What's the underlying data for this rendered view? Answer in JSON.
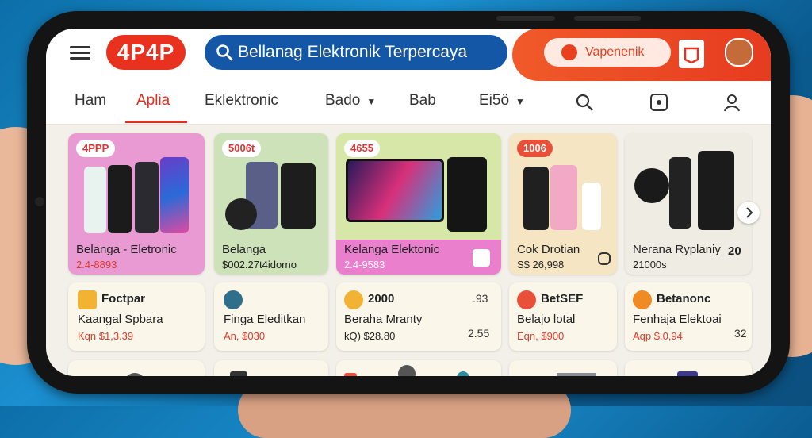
{
  "header": {
    "logo": "4P4P",
    "search_text": "Bellanag Elektronik Terpercaya",
    "promo_label": "Vapenenik"
  },
  "tabs": [
    {
      "label": "Ham"
    },
    {
      "label": "Aplia"
    },
    {
      "label": "Eklektronic"
    },
    {
      "label": "Bado"
    },
    {
      "label": "Bab"
    },
    {
      "label": "Ei5ö"
    }
  ],
  "product_cards": [
    {
      "badge": "4PPP",
      "title": "Belanga - Eletronic",
      "price": "2.4-8893",
      "bg": "#e99ad3"
    },
    {
      "badge": "5006t",
      "title": "Belanga",
      "price": "$002.27t4idorno",
      "bg": "#cde2b8"
    },
    {
      "badge": "4655",
      "title": "Kelanga Elektonic",
      "price": "2.4-9583",
      "bg": "#d6e7a8"
    },
    {
      "badge": "1006",
      "title": "Cok Drotian",
      "price": "S$ 26,998",
      "bg": "#f6e5c2"
    },
    {
      "badge": "",
      "title": "Nerana Ryplaniy",
      "price": "21000s",
      "extra": "20",
      "bg": "#efece4"
    }
  ],
  "store_cards": [
    {
      "title": "Foctpar",
      "sub": "Kaangal Spbara",
      "price": "Kqn $1,3.39",
      "num": "",
      "icon_color": "#f2b233"
    },
    {
      "title": "",
      "sub": "Finga Eleditkan",
      "price": "An, $030",
      "num": "",
      "icon_color": "#2f6f8c"
    },
    {
      "title": "2000",
      "sub": "Beraha Mranty",
      "price": "kQ) $28.80",
      "num": ".93",
      "num2": "2.55",
      "icon_color": "#f2b233"
    },
    {
      "title": "BetSEF",
      "sub": "Belajo lotal",
      "price": "Eqn, $900",
      "num": "",
      "icon_color": "#e8503a"
    },
    {
      "title": "Betanonc",
      "sub": "Fenhaja Elektoai",
      "price": "Aqp $.0,94",
      "num": "32",
      "icon_color": "#f08a24"
    }
  ],
  "colors": {
    "accent_red": "#e8321f",
    "search_blue": "#1457a6",
    "tab_active": "#e22d1f",
    "price_red": "#e03b2a"
  }
}
